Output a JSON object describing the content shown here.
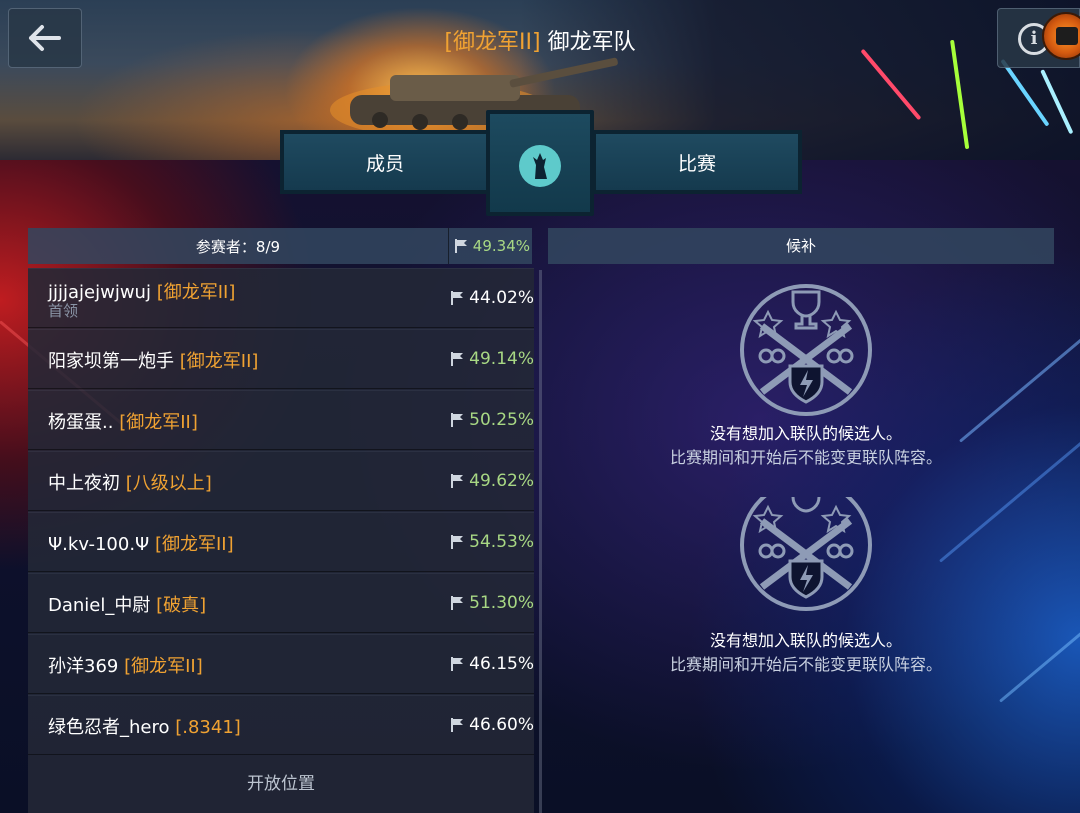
{
  "header": {
    "clan_tag": "[御龙军II]",
    "team_name": "御龙军队"
  },
  "tabs": {
    "left": "成员",
    "right": "比赛"
  },
  "participants": {
    "label": "参赛者：8/9",
    "avg_rate": "49.34%",
    "open_slot": "开放位置",
    "rows": [
      {
        "name": "jjjjajejwjwuj",
        "clan": "[御龙军II]",
        "role": "首领",
        "rate": "44.02%",
        "rate_color": "#ffffff"
      },
      {
        "name": "阳家坝第一炮手",
        "clan": "[御龙军II]",
        "role": "",
        "rate": "49.14%",
        "rate_color": "#a8d884"
      },
      {
        "name": "杨蛋蛋..",
        "clan": "[御龙军II]",
        "role": "",
        "rate": "50.25%",
        "rate_color": "#a8d884"
      },
      {
        "name": "中上夜初",
        "clan": "[八级以上]",
        "role": "",
        "rate": "49.62%",
        "rate_color": "#a8d884"
      },
      {
        "name": "Ψ.kv-100.Ψ",
        "clan": "[御龙军II]",
        "role": "",
        "rate": "54.53%",
        "rate_color": "#a8d884"
      },
      {
        "name": "Daniel_中尉",
        "clan": "[破真]",
        "role": "",
        "rate": "51.30%",
        "rate_color": "#a8d884"
      },
      {
        "name": "孙洋369",
        "clan": "[御龙军II]",
        "role": "",
        "rate": "46.15%",
        "rate_color": "#ffffff"
      },
      {
        "name": "绿色忍者_hero",
        "clan": "[.8341]",
        "role": "",
        "rate": "46.60%",
        "rate_color": "#ffffff"
      }
    ]
  },
  "reserves": {
    "label": "候补",
    "empty_line1": "没有想加入联队的候选人。",
    "empty_line2": "比赛期间和开始后不能变更联队阵容。"
  },
  "icons": {
    "back": "arrow-left-icon",
    "info": "info-icon",
    "emblem": "wolf-emblem-icon",
    "flag": "flag-icon",
    "empty": "trophy-crossed-guns-emblem-icon"
  }
}
